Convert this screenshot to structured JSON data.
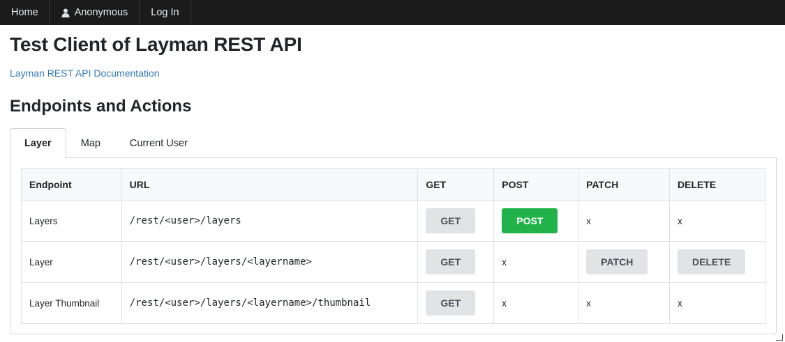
{
  "nav": {
    "home": "Home",
    "user": "Anonymous",
    "login": "Log In"
  },
  "page_title": "Test Client of Layman REST API",
  "doc_link": "Layman REST API Documentation",
  "section_title": "Endpoints and Actions",
  "tabs": [
    {
      "label": "Layer",
      "active": true
    },
    {
      "label": "Map",
      "active": false
    },
    {
      "label": "Current User",
      "active": false
    }
  ],
  "table": {
    "headers": [
      "Endpoint",
      "URL",
      "GET",
      "POST",
      "PATCH",
      "DELETE"
    ],
    "rows": [
      {
        "endpoint": "Layers",
        "url": "/rest/<user>/layers",
        "get": "GET",
        "post": "POST",
        "patch": "x",
        "delete": "x"
      },
      {
        "endpoint": "Layer",
        "url": "/rest/<user>/layers/<layername>",
        "get": "GET",
        "post": "x",
        "patch": "PATCH",
        "delete": "DELETE"
      },
      {
        "endpoint": "Layer Thumbnail",
        "url": "/rest/<user>/layers/<layername>/thumbnail",
        "get": "GET",
        "post": "x",
        "patch": "x",
        "delete": "x"
      }
    ]
  },
  "colors": {
    "navbar": "#1b1b1b",
    "link": "#337ab7",
    "post_button": "#21b34a",
    "secondary_button": "#e2e3e5"
  }
}
